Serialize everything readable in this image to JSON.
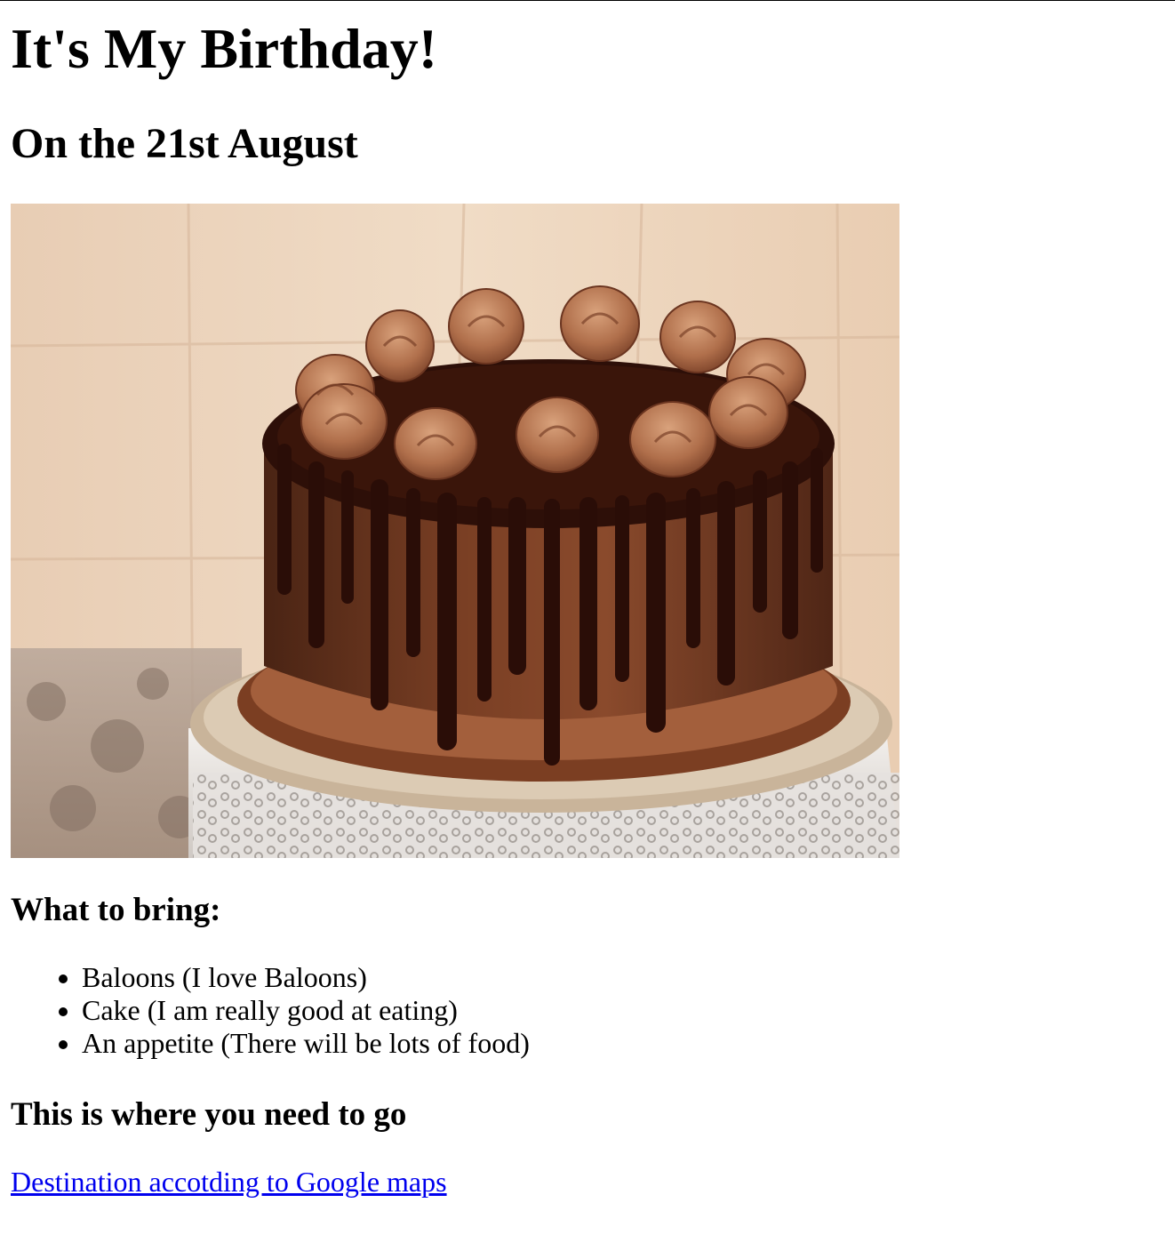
{
  "page": {
    "title": "It's My Birthday!",
    "subtitle": "On the 21st August"
  },
  "image": {
    "alt": "Chocolate drip cake"
  },
  "bring": {
    "heading": "What to bring:",
    "items": [
      "Baloons (I love Baloons)",
      "Cake (I am really good at eating)",
      "An appetite (There will be lots of food)"
    ]
  },
  "directions": {
    "heading": "This is where you need to go",
    "link_text": "Destination accotding to Google maps"
  },
  "colors": {
    "link": "#0000ee",
    "background": "#ffffff",
    "text": "#000000"
  }
}
